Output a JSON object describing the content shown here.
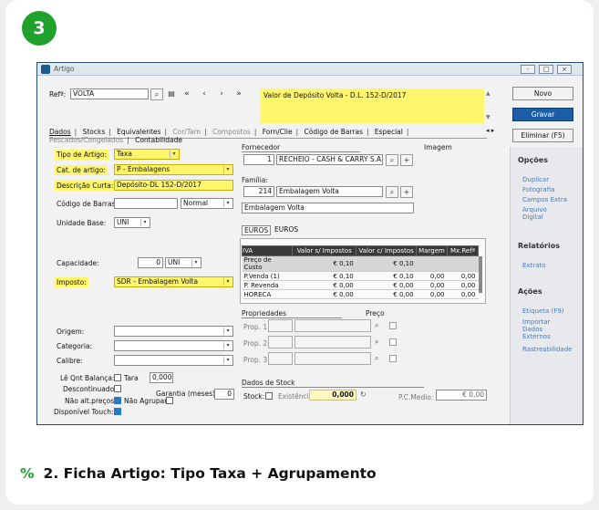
{
  "step_number": "3",
  "caption": {
    "icon": "%",
    "text": "2. Ficha Artigo: Tipo Taxa + Agrupamento"
  },
  "window": {
    "title": "Artigo",
    "controls": [
      "-",
      "□",
      "×"
    ],
    "ref_label": "Refª:",
    "ref_value": "VOLTA",
    "header_desc": "Valor de Depósito Volta - D.L. 152-D/2017",
    "nav": [
      "«",
      "‹",
      "›",
      "»"
    ]
  },
  "tabs": [
    {
      "label": "Dados",
      "state": "active"
    },
    {
      "label": "Stocks",
      "state": "normal"
    },
    {
      "label": "Equivalentes",
      "state": "normal"
    },
    {
      "label": "Cor/Tam",
      "state": "disabled"
    },
    {
      "label": "Compostos",
      "state": "disabled"
    },
    {
      "label": "Forn/Clie",
      "state": "normal"
    },
    {
      "label": "Código de Barras",
      "state": "normal"
    },
    {
      "label": "Especial",
      "state": "normal"
    },
    {
      "label": "Pescados/Congelados",
      "state": "disabled"
    },
    {
      "label": "Contabilidade",
      "state": "normal"
    }
  ],
  "actions": {
    "new": "Novo",
    "save": "Gravar",
    "delete": "Eliminar (F5)"
  },
  "form": {
    "tipo_label": "Tipo de Artigo:",
    "tipo_value": "Taxa",
    "cat_label": "Cat. de artigo:",
    "cat_value": "P - Embalagens",
    "desc_label": "Descrição Curta:",
    "desc_value": "Depósito-DL 152-D/2017",
    "barras_label": "Código de Barras:",
    "barras_type": "Normal",
    "unidade_label": "Unidade Base:",
    "unidade_value": "UNI",
    "capacidade_label": "Capacidade:",
    "capacidade_value": "0",
    "capacidade_unit": "UNI",
    "imposto_label": "Imposto:",
    "imposto_value": "SDR - Embalagem Volta",
    "origem_label": "Origem:",
    "categoria_label": "Categoria:",
    "calibre_label": "Calibre:",
    "le_qnt_label": "Lê Qnt Balança:",
    "tara_label": "Tara",
    "tara_value": "0,000",
    "descontinuado_label": "Descontinuado:",
    "garantia_label": "Garantia (meses):",
    "garantia_value": "0",
    "nao_alt_label": "Não alt.preços:",
    "nao_agrupar_label": "Não Agrupar",
    "touch_label": "Disponível Touch:"
  },
  "fornecedor": {
    "label": "Fornecedor",
    "imagem_label": "Imagem",
    "code": "1",
    "name": "RECHEIO - CASH & CARRY S.A."
  },
  "familia": {
    "label": "Família:",
    "code": "214",
    "name": "Embalagem Volta",
    "desc": "Embalagem Volta"
  },
  "price_tabs": [
    "EUROS",
    "EUROS"
  ],
  "price_grid": {
    "headers": [
      "IVA",
      "Valor s/ Impostos",
      "Valor c/ Impostos",
      "Margem",
      "Mx.Refª"
    ],
    "rows": [
      [
        "Preço de Custo",
        "€ 0,10",
        "€ 0,10",
        "",
        ""
      ],
      [
        "P.Venda (1)",
        "€ 0,10",
        "€ 0,10",
        "0,00",
        "0,00"
      ],
      [
        "P. Revenda",
        "€ 0,00",
        "€ 0,00",
        "0,00",
        "0,00"
      ],
      [
        "HORECA",
        "€ 0,00",
        "€ 0,00",
        "0,00",
        "0,00"
      ]
    ]
  },
  "propriedades": {
    "label": "Propriedades",
    "preco_label": "Preço",
    "items": [
      "Prop. 1:",
      "Prop. 2:",
      "Prop. 3:"
    ]
  },
  "stock": {
    "label": "Dados de Stock",
    "stock_label": "Stock:",
    "existencia_label": "Existência:",
    "existencia_value": "0,000",
    "pcm_label": "P.C.Medio:",
    "pcm_value": "€ 0,00"
  },
  "sidebar": {
    "opcoes_title": "Opções",
    "opcoes": [
      "Duplicar",
      "Fotografia",
      "Campos Extra",
      "Arquivo Digital"
    ],
    "relatorios_title": "Relatórios",
    "relatorios": [
      "Extrato"
    ],
    "acoes_title": "Ações",
    "acoes": [
      "Etiqueta (F9)",
      "Importar Dados Externos",
      "Rastreabilidade"
    ]
  },
  "colors": {
    "highlight": "#fff66e",
    "accent": "#1a5ea8",
    "badge": "#1fa12b"
  }
}
